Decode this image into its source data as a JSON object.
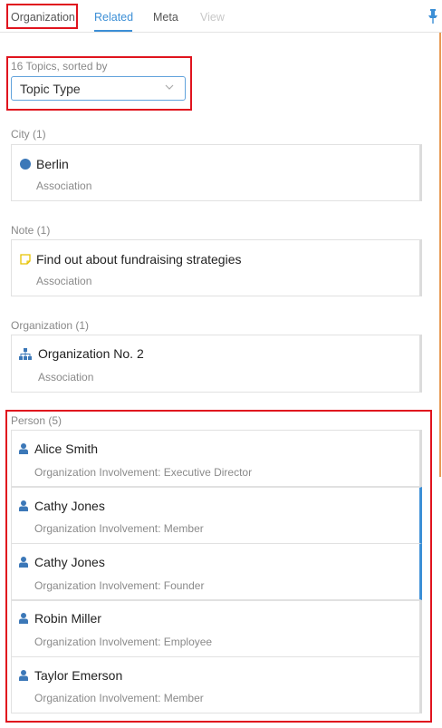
{
  "tabs": [
    {
      "label": "Organization"
    },
    {
      "label": "Related"
    },
    {
      "label": "Meta"
    },
    {
      "label": "View"
    }
  ],
  "sort": {
    "caption": "16 Topics, sorted by",
    "value": "Topic Type"
  },
  "groups": {
    "city": {
      "caption": "City (1)",
      "items": [
        {
          "title": "Berlin",
          "sub": "Association",
          "icon": "circle-icon"
        }
      ]
    },
    "note": {
      "caption": "Note (1)",
      "items": [
        {
          "title": "Find out about fundraising strategies",
          "sub": "Association",
          "icon": "note-icon"
        }
      ]
    },
    "organization": {
      "caption": "Organization (1)",
      "items": [
        {
          "title": "Organization No. 2",
          "sub": "Association",
          "icon": "org-chart-icon"
        }
      ]
    },
    "person": {
      "caption": "Person (5)",
      "items": [
        {
          "title": "Alice Smith",
          "sub": "Organization Involvement: Executive Director",
          "icon": "person-icon"
        },
        {
          "title": "Cathy Jones",
          "sub": "Organization Involvement: Member",
          "icon": "person-icon"
        },
        {
          "title": "Cathy Jones",
          "sub": "Organization Involvement: Founder",
          "icon": "person-icon"
        },
        {
          "title": "Robin Miller",
          "sub": "Organization Involvement: Employee",
          "icon": "person-icon"
        },
        {
          "title": "Taylor Emerson",
          "sub": "Organization Involvement: Member",
          "icon": "person-icon"
        }
      ]
    }
  },
  "colors": {
    "accent": "#3c8fd6",
    "icon": "#3c78b8",
    "note_icon": "#e8c200",
    "highlight": "#e0141e",
    "rail": "#e89a55"
  }
}
